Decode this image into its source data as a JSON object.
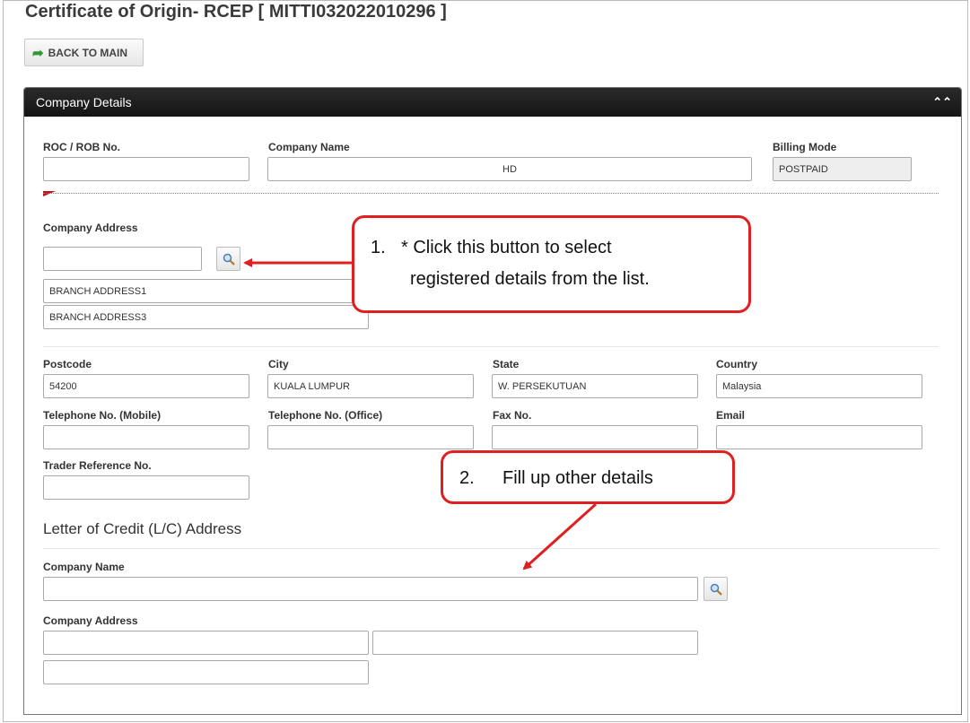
{
  "page": {
    "title": "Certificate of Origin- RCEP [ MITTI032022010296 ]",
    "back_button": "BACK TO MAIN"
  },
  "panel": {
    "title": "Company Details"
  },
  "company": {
    "roc_label": "ROC / ROB No.",
    "roc_value": "",
    "name_label": "Company Name",
    "name_value": "HD",
    "billing_label": "Billing Mode",
    "billing_value": "POSTPAID",
    "address_label": "Company Address",
    "address_code": "",
    "address_line1": "BRANCH ADDRESS1",
    "address_line3": "BRANCH ADDRESS3"
  },
  "location": {
    "postcode_label": "Postcode",
    "postcode_value": "54200",
    "city_label": "City",
    "city_value": "KUALA LUMPUR",
    "state_label": "State",
    "state_value": "W. PERSEKUTUAN",
    "country_label": "Country",
    "country_value": "Malaysia"
  },
  "contact": {
    "mobile_label": "Telephone No. (Mobile)",
    "office_label": "Telephone No. (Office)",
    "fax_label": "Fax No.",
    "email_label": "Email",
    "trader_ref_label": "Trader Reference No."
  },
  "lc": {
    "section_title": "Letter of Credit (L/C) Address",
    "name_label": "Company Name",
    "address_label": "Company Address"
  },
  "callouts": {
    "one_num": "1.",
    "one_line1": "* Click this button to select",
    "one_line2": "registered details from the list.",
    "two_num": "2.",
    "two_text": "Fill up other details"
  },
  "icons": {
    "back": "back-arrow-icon",
    "search": "magnifier-icon",
    "collapse": "double-chevron-up-icon"
  },
  "colors": {
    "panel_header": "#1c1c1c",
    "callout_border": "#e02020",
    "back_arrow": "#2e9a2e"
  }
}
